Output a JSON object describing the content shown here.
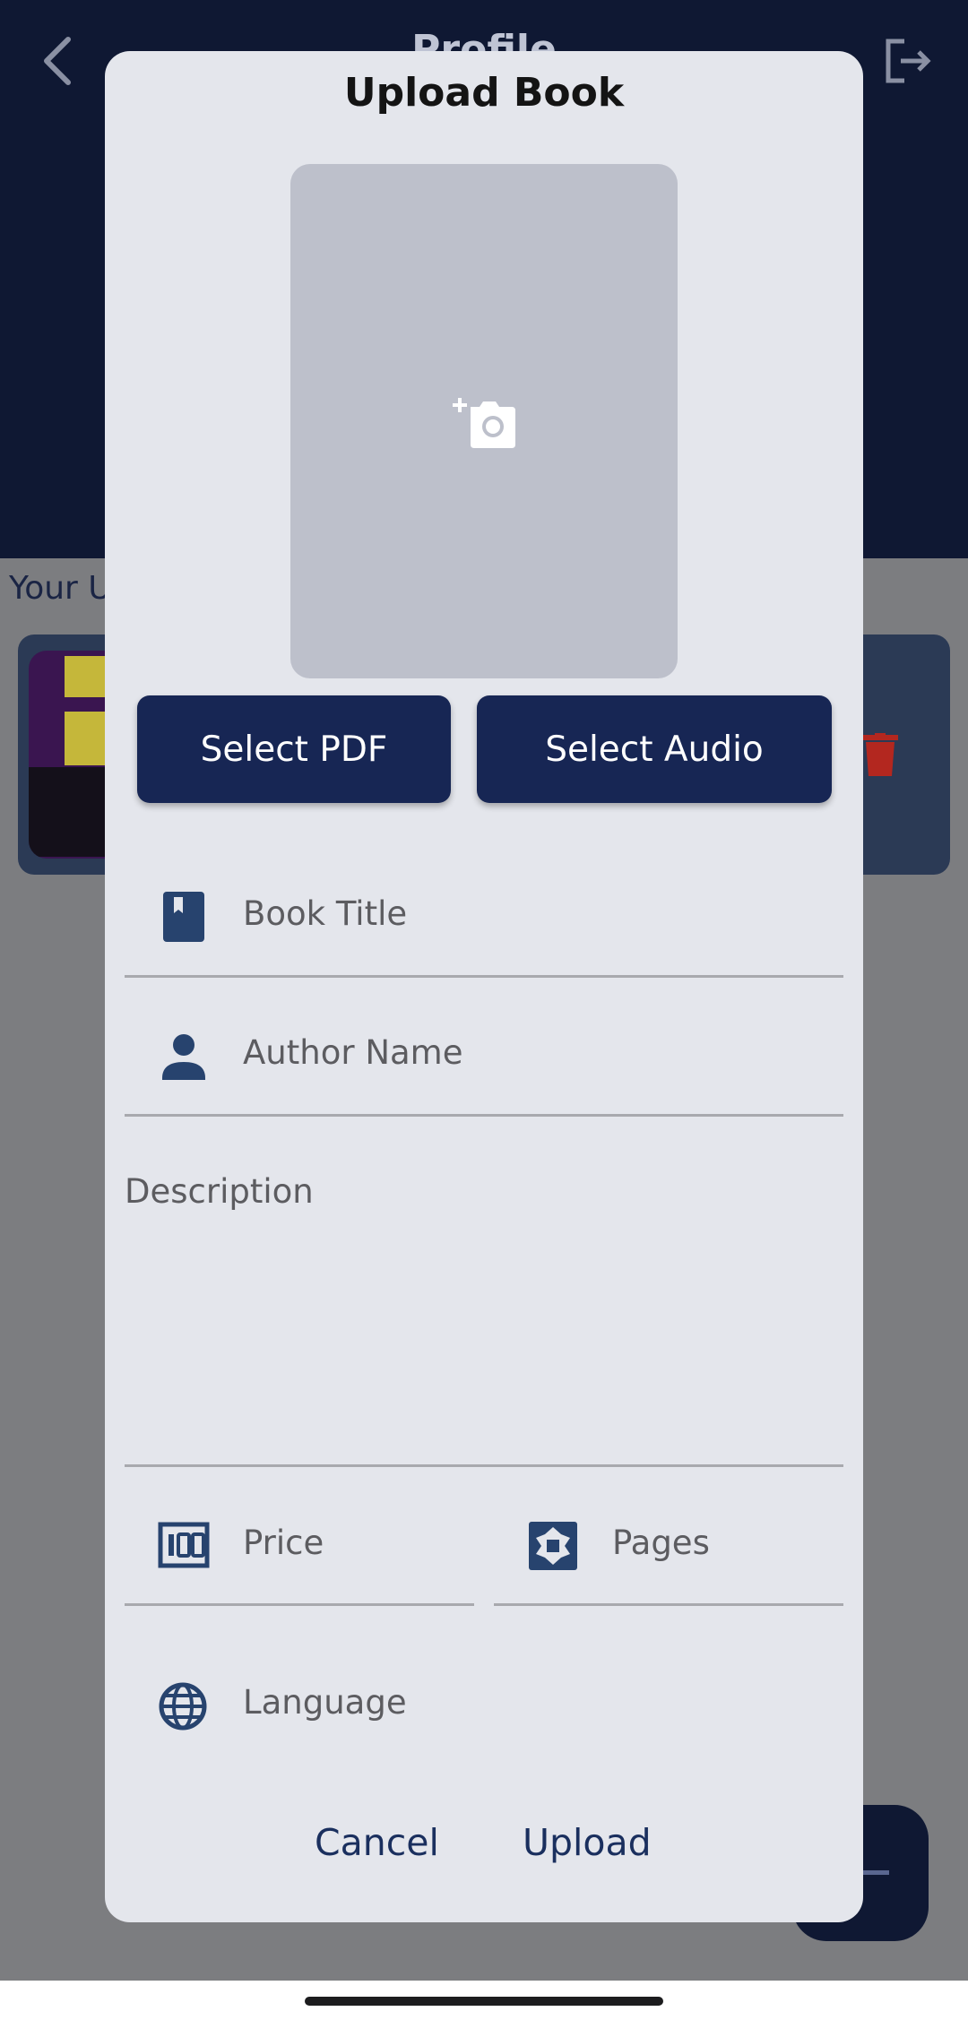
{
  "background": {
    "header_title": "Profile",
    "section_heading": "Your U"
  },
  "dialog": {
    "title": "Upload Book",
    "cover_icon": "add-a-photo-icon",
    "buttons": {
      "select_pdf": "Select PDF",
      "select_audio": "Select Audio"
    },
    "fields": {
      "book_title": "Book Title",
      "author_name": "Author Name",
      "description": "Description",
      "price": "Price",
      "pages": "Pages",
      "language": "Language"
    },
    "actions": {
      "cancel": "Cancel",
      "upload": "Upload"
    }
  },
  "colors": {
    "header_navy": "#0f1833",
    "button_navy": "#172654",
    "dialog_bg": "#e4e6ec",
    "icon_blue": "#27436e",
    "action_text": "#1a2f5e",
    "delete_red": "#b3271f"
  }
}
